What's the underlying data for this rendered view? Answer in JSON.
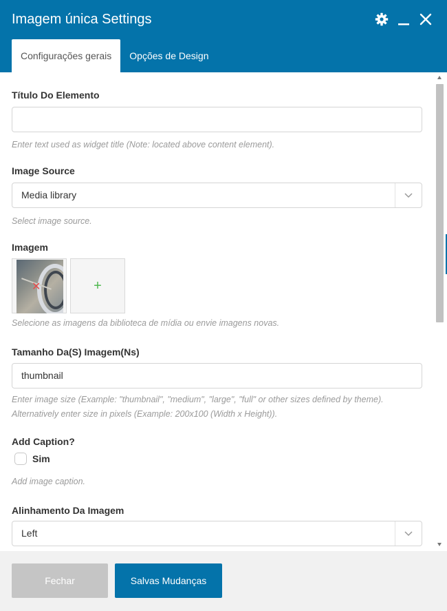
{
  "window": {
    "title": "Imagem única Settings"
  },
  "header_icons": [
    "gear-icon",
    "minimize-icon",
    "close-icon"
  ],
  "tabs": [
    {
      "label": "Configurações gerais",
      "active": true
    },
    {
      "label": "Opções de Design",
      "active": false
    }
  ],
  "fields": {
    "title": {
      "label": "Título Do Elemento",
      "value": "",
      "help": "Enter text used as widget title (Note: located above content element)."
    },
    "image_source": {
      "label": "Image Source",
      "value": "Media library",
      "help": "Select image source."
    },
    "image": {
      "label": "Imagem",
      "help": "Selecione as imagens da biblioteca de mídia ou envie imagens novas."
    },
    "image_size": {
      "label": "Tamanho Da(S) Imagem(Ns)",
      "value": "thumbnail",
      "help": "Enter image size (Example: \"thumbnail\", \"medium\", \"large\", \"full\" or other sizes defined by theme). Alternatively enter size in pixels (Example: 200x100 (Width x Height))."
    },
    "add_caption": {
      "label": "Add Caption?",
      "checkbox_label": "Sim",
      "checked": false,
      "help": "Add image caption."
    },
    "alignment": {
      "label": "Alinhamento Da Imagem",
      "value": "Left"
    }
  },
  "footer": {
    "close_label": "Fechar",
    "save_label": "Salvas Mudanças"
  },
  "colors": {
    "header": "#0473aa",
    "primary_button": "#0473aa",
    "disabled_button": "#c5c5c5",
    "add_icon": "#4fb84f",
    "remove_icon": "#e74c4c"
  }
}
